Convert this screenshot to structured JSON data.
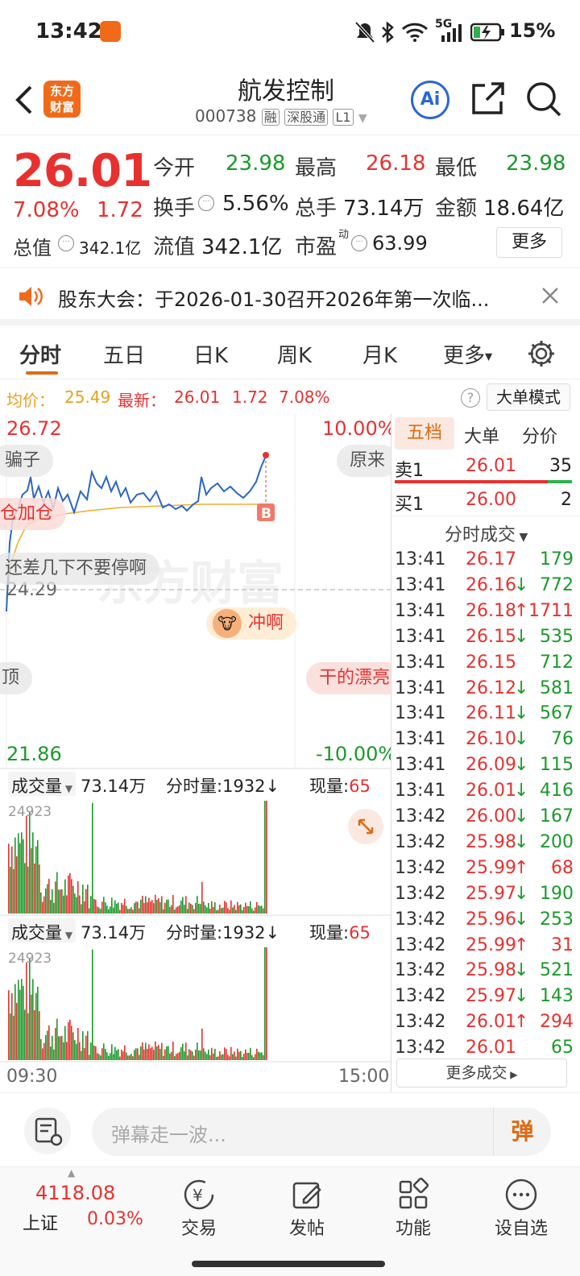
{
  "status": {
    "time": "13:42",
    "battery": "15%",
    "network": "5G"
  },
  "header": {
    "stock_name": "航发控制",
    "stock_code": "000738",
    "tags": [
      "融",
      "深股通",
      "L1"
    ],
    "logo_text": [
      "东方",
      "财富"
    ],
    "ai_label": "Ai"
  },
  "quote": {
    "price": "26.01",
    "change_pct": "7.08%",
    "change": "1.72",
    "open_label": "今开",
    "open": "23.98",
    "high_label": "最高",
    "high": "26.18",
    "low_label": "最低",
    "low": "23.98",
    "turnover_label": "换手",
    "turnover": "5.56%",
    "volume_label": "总手",
    "volume": "73.14万",
    "amount_label": "金额",
    "amount": "18.64亿",
    "mktcap_label": "总值",
    "mktcap": "342.1亿",
    "float_label": "流值",
    "float": "342.1亿",
    "pe_label": "市盈",
    "pe_sup": "动",
    "pe": "63.99",
    "more_label": "更多"
  },
  "notice": {
    "text": "股东大会：于2026-01-30召开2026年第一次临..."
  },
  "tabs": [
    "分时",
    "五日",
    "日K",
    "周K",
    "月K",
    "更多"
  ],
  "infobar": {
    "avg_label": "均价：",
    "avg": "25.49",
    "latest_label": "最新：",
    "latest": "26.01",
    "chg": "1.72",
    "pct": "7.08%",
    "mode_label": "大单模式"
  },
  "chart": {
    "price_max": "26.72",
    "price_min": "21.86",
    "pct_max": "10.00%",
    "pct_min": "-10.00%",
    "prev_close": "24.29",
    "vol_label": "成交量",
    "vol_total": "73.14万",
    "tick_label": "分时量:1932↓",
    "now_label": "现量:",
    "now": "65",
    "vol_max": "24923",
    "time_start": "09:30",
    "time_end": "15:00",
    "buy_marker": "B",
    "watermark": "东方财富"
  },
  "danmaku": [
    "骗子",
    "原来",
    "仓加仓",
    "还差几下不要停啊",
    "冲啊",
    "顶",
    "干的漂亮"
  ],
  "side": {
    "tabs": [
      "五档",
      "大单",
      "分价"
    ],
    "sell1": {
      "label": "卖1",
      "price": "26.01",
      "vol": "35"
    },
    "buy1": {
      "label": "买1",
      "price": "26.00",
      "vol": "2"
    },
    "ticks_title": "分时成交",
    "ticks": [
      {
        "t": "13:41",
        "p": "26.17",
        "v": "179",
        "d": ""
      },
      {
        "t": "13:41",
        "p": "26.16",
        "v": "772",
        "d": "↓"
      },
      {
        "t": "13:41",
        "p": "26.18",
        "v": "1711",
        "d": "↑"
      },
      {
        "t": "13:41",
        "p": "26.15",
        "v": "535",
        "d": "↓"
      },
      {
        "t": "13:41",
        "p": "26.15",
        "v": "712",
        "d": ""
      },
      {
        "t": "13:41",
        "p": "26.12",
        "v": "581",
        "d": "↓"
      },
      {
        "t": "13:41",
        "p": "26.11",
        "v": "567",
        "d": "↓"
      },
      {
        "t": "13:41",
        "p": "26.10",
        "v": "76",
        "d": "↓"
      },
      {
        "t": "13:41",
        "p": "26.09",
        "v": "115",
        "d": "↓"
      },
      {
        "t": "13:41",
        "p": "26.01",
        "v": "416",
        "d": "↓"
      },
      {
        "t": "13:42",
        "p": "26.00",
        "v": "167",
        "d": "↓"
      },
      {
        "t": "13:42",
        "p": "25.98",
        "v": "200",
        "d": "↓"
      },
      {
        "t": "13:42",
        "p": "25.99",
        "v": "68",
        "d": "↑"
      },
      {
        "t": "13:42",
        "p": "25.97",
        "v": "190",
        "d": "↓"
      },
      {
        "t": "13:42",
        "p": "25.96",
        "v": "253",
        "d": "↓"
      },
      {
        "t": "13:42",
        "p": "25.99",
        "v": "31",
        "d": "↑"
      },
      {
        "t": "13:42",
        "p": "25.98",
        "v": "521",
        "d": "↓"
      },
      {
        "t": "13:42",
        "p": "25.97",
        "v": "143",
        "d": "↓"
      },
      {
        "t": "13:42",
        "p": "26.01",
        "v": "294",
        "d": "↑"
      },
      {
        "t": "13:42",
        "p": "26.01",
        "v": "65",
        "d": ""
      }
    ],
    "more_ticks": "更多成交"
  },
  "comment": {
    "placeholder": "弹幕走一波...",
    "send_label": "弹"
  },
  "bottom": {
    "index_value": "4118.08",
    "index_name": "上证",
    "index_pct": "0.03%",
    "items": [
      "交易",
      "发帖",
      "功能",
      "设自选"
    ]
  },
  "colors": {
    "up": "#e8312f",
    "down": "#1a9a2a",
    "accent": "#e06a12",
    "avg_line": "#f0b030",
    "price_line": "#2b66c7"
  }
}
